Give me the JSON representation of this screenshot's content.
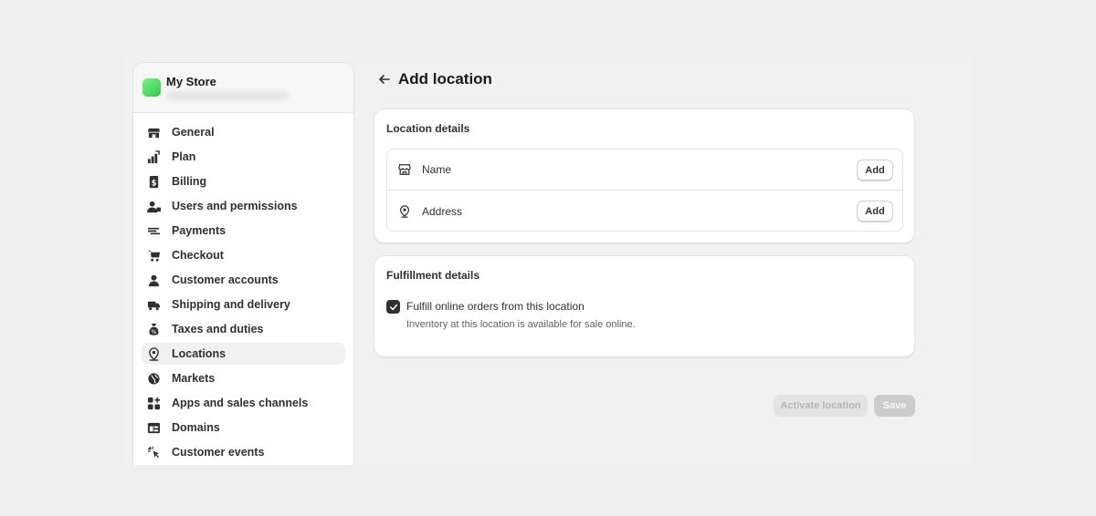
{
  "store": {
    "name": "My Store"
  },
  "sidebar": {
    "items": [
      {
        "label": "General",
        "icon": "store-icon"
      },
      {
        "label": "Plan",
        "icon": "plan-icon"
      },
      {
        "label": "Billing",
        "icon": "billing-icon"
      },
      {
        "label": "Users and permissions",
        "icon": "users-icon"
      },
      {
        "label": "Payments",
        "icon": "payments-icon"
      },
      {
        "label": "Checkout",
        "icon": "cart-icon"
      },
      {
        "label": "Customer accounts",
        "icon": "person-icon"
      },
      {
        "label": "Shipping and delivery",
        "icon": "truck-icon"
      },
      {
        "label": "Taxes and duties",
        "icon": "tax-bag-icon"
      },
      {
        "label": "Locations",
        "icon": "location-pin-icon",
        "active": true
      },
      {
        "label": "Markets",
        "icon": "globe-icon"
      },
      {
        "label": "Apps and sales channels",
        "icon": "apps-icon"
      },
      {
        "label": "Domains",
        "icon": "domains-icon"
      },
      {
        "label": "Customer events",
        "icon": "cursor-click-icon"
      }
    ]
  },
  "page": {
    "title": "Add location"
  },
  "location_details": {
    "title": "Location details",
    "rows": [
      {
        "label": "Name",
        "button": "Add",
        "icon": "store-icon"
      },
      {
        "label": "Address",
        "button": "Add",
        "icon": "location-pin-icon"
      }
    ]
  },
  "fulfillment": {
    "title": "Fulfillment details",
    "checkbox_label": "Fulfill online orders from this location",
    "checked": true,
    "help_text": "Inventory at this location is available for sale online."
  },
  "actions": {
    "activate_label": "Activate location",
    "save_label": "Save"
  },
  "colors": {
    "background": "#efefef",
    "card": "#ffffff",
    "text": "#303030",
    "disabled_button": "#e3e3e3",
    "store_avatar": "#2fc94a"
  }
}
